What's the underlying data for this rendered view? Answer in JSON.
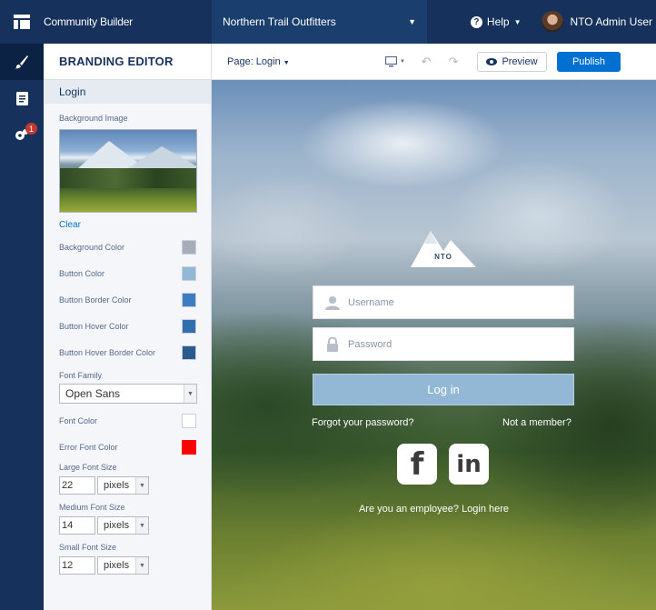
{
  "app": {
    "name": "Community Builder",
    "site_name": "Northern Trail Outfitters",
    "help_label": "Help",
    "user_name": "NTO Admin User"
  },
  "rail": {
    "settings_badge_count": "1"
  },
  "panel": {
    "title": "BRANDING EDITOR",
    "section": "Login",
    "background_image_label": "Background Image",
    "clear_label": "Clear",
    "color_rows": [
      {
        "label": "Background Color",
        "color": "#a5adb8"
      },
      {
        "label": "Button Color",
        "color": "#92b8d6"
      },
      {
        "label": "Button Border Color",
        "color": "#3b7dc4"
      },
      {
        "label": "Button Hover Color",
        "color": "#2f6fb0"
      },
      {
        "label": "Button Hover Border Color",
        "color": "#2b5a8e"
      }
    ],
    "font_family_label": "Font Family",
    "font_family_value": "Open Sans",
    "font_color_label": "Font Color",
    "font_color": "#ffffff",
    "error_font_color_label": "Error Font Color",
    "error_font_color": "#ff0000",
    "sizes": [
      {
        "label": "Large Font Size",
        "value": "22",
        "unit": "pixels"
      },
      {
        "label": "Medium Font Size",
        "value": "14",
        "unit": "pixels"
      },
      {
        "label": "Small Font Size",
        "value": "12",
        "unit": "pixels"
      }
    ]
  },
  "toolbar": {
    "page_label": "Page: Login",
    "preview_label": "Preview",
    "publish_label": "Publish"
  },
  "login": {
    "logo_text": "NTO",
    "username_placeholder": "Username",
    "password_placeholder": "Password",
    "login_button": "Log in",
    "forgot_password": "Forgot your password?",
    "not_member": "Not a member?",
    "facebook_glyph": "f",
    "linkedin_glyph": "in",
    "employee_link": "Are you an employee? Login here"
  },
  "colors": {
    "nav_bg": "#16325c",
    "accent": "#0070d2"
  }
}
